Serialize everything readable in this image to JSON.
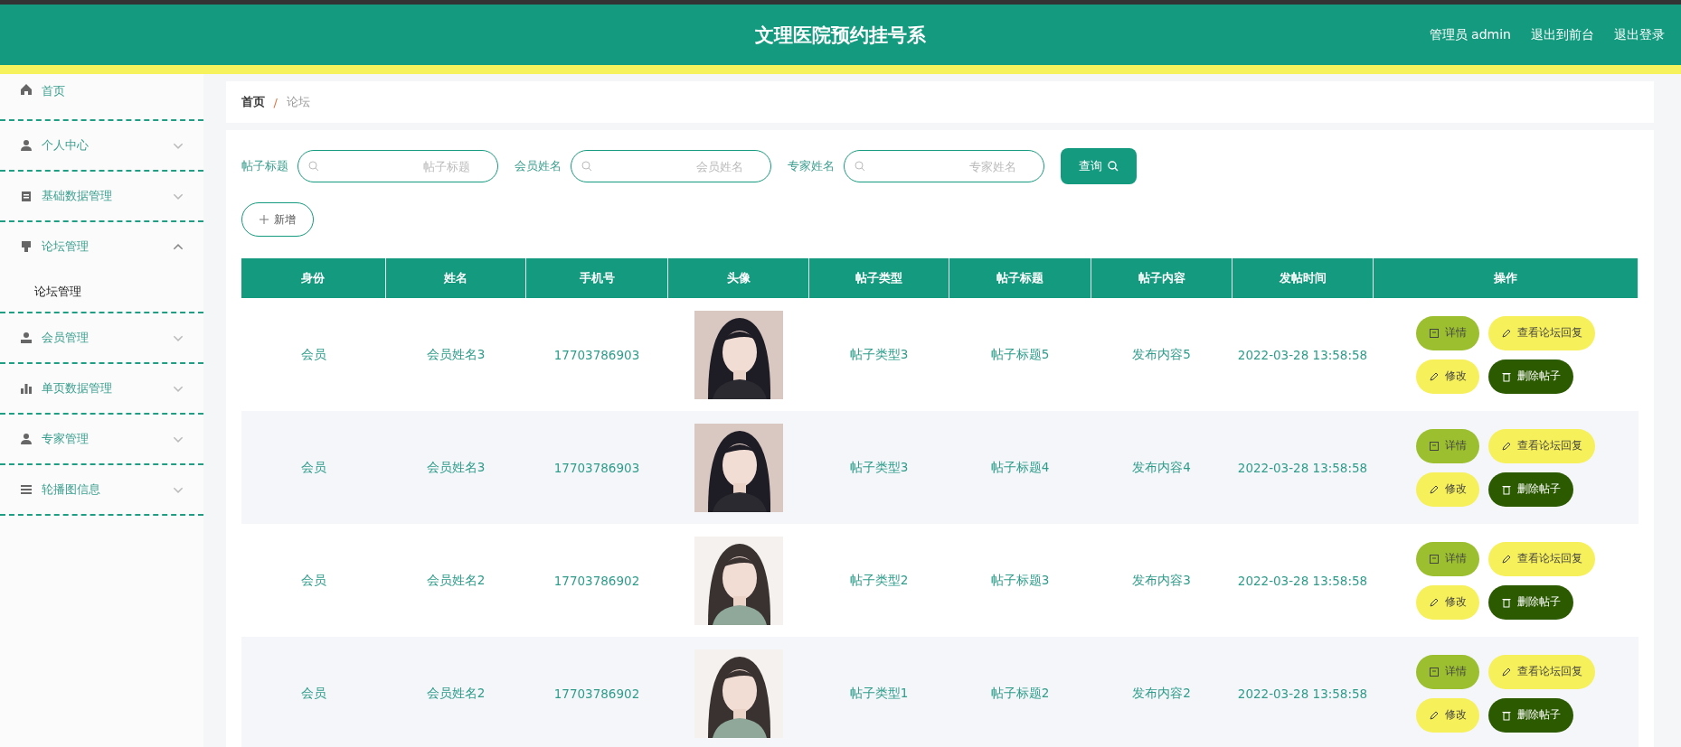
{
  "header": {
    "title": "文理医院预约挂号系",
    "user": "管理员 admin",
    "links": [
      "退出到前台",
      "退出登录"
    ]
  },
  "sidebar": {
    "items": [
      {
        "label": "首页"
      },
      {
        "label": "个人中心",
        "expanded": false
      },
      {
        "label": "基础数据管理",
        "expanded": false
      },
      {
        "label": "论坛管理",
        "expanded": true,
        "children": [
          {
            "label": "论坛管理"
          }
        ]
      },
      {
        "label": "会员管理",
        "expanded": false
      },
      {
        "label": "单页数据管理",
        "expanded": false
      },
      {
        "label": "专家管理",
        "expanded": false
      },
      {
        "label": "轮播图信息",
        "expanded": false
      }
    ]
  },
  "breadcrumb": {
    "items": [
      "首页",
      "论坛"
    ],
    "separator": "/"
  },
  "search": {
    "fields": [
      {
        "label": "帖子标题",
        "placeholder": "帖子标题"
      },
      {
        "label": "会员姓名",
        "placeholder": "会员姓名"
      },
      {
        "label": "专家姓名",
        "placeholder": "专家姓名"
      }
    ],
    "button": "查询"
  },
  "add_button": "新增",
  "table": {
    "columns": [
      "身份",
      "姓名",
      "手机号",
      "头像",
      "帖子类型",
      "帖子标题",
      "帖子内容",
      "发帖时间",
      "操作"
    ],
    "rows": [
      {
        "cells": [
          "会员",
          "会员姓名3",
          "17703786903",
          {
            "kind": "picture"
          },
          "帖子类型3",
          "帖子标题5",
          "发布内容5",
          "2022-03-28 13:58:58"
        ],
        "actions": [
          {
            "kind": "detail",
            "label": "详情"
          },
          {
            "kind": "reply",
            "label": "查看论坛回复"
          },
          {
            "kind": "edit",
            "label": "修改"
          },
          {
            "kind": "delete",
            "label": "删除帖子"
          }
        ]
      },
      {
        "cells": [
          "会员",
          "会员姓名3",
          "17703786903",
          {
            "kind": "picture"
          },
          "帖子类型3",
          "帖子标题4",
          "发布内容4",
          "2022-03-28 13:58:58"
        ],
        "actions": [
          {
            "kind": "detail",
            "label": "详情"
          },
          {
            "kind": "reply",
            "label": "查看论坛回复"
          },
          {
            "kind": "edit",
            "label": "修改"
          },
          {
            "kind": "delete",
            "label": "删除帖子"
          }
        ]
      },
      {
        "cells": [
          "会员",
          "会员姓名2",
          "17703786902",
          {
            "kind": "picture"
          },
          "帖子类型2",
          "帖子标题3",
          "发布内容3",
          "2022-03-28 13:58:58"
        ],
        "actions": [
          {
            "kind": "detail",
            "label": "详情"
          },
          {
            "kind": "reply",
            "label": "查看论坛回复"
          },
          {
            "kind": "edit",
            "label": "修改"
          },
          {
            "kind": "delete",
            "label": "删除帖子"
          }
        ]
      },
      {
        "cells": [
          "会员",
          "会员姓名2",
          "17703786902",
          {
            "kind": "picture"
          },
          "帖子类型1",
          "帖子标题2",
          "发布内容2",
          "2022-03-28 13:58:58"
        ],
        "actions": [
          {
            "kind": "detail",
            "label": "详情"
          },
          {
            "kind": "reply",
            "label": "查看论坛回复"
          },
          {
            "kind": "edit",
            "label": "修改"
          },
          {
            "kind": "delete",
            "label": "删除帖子"
          }
        ]
      }
    ]
  }
}
